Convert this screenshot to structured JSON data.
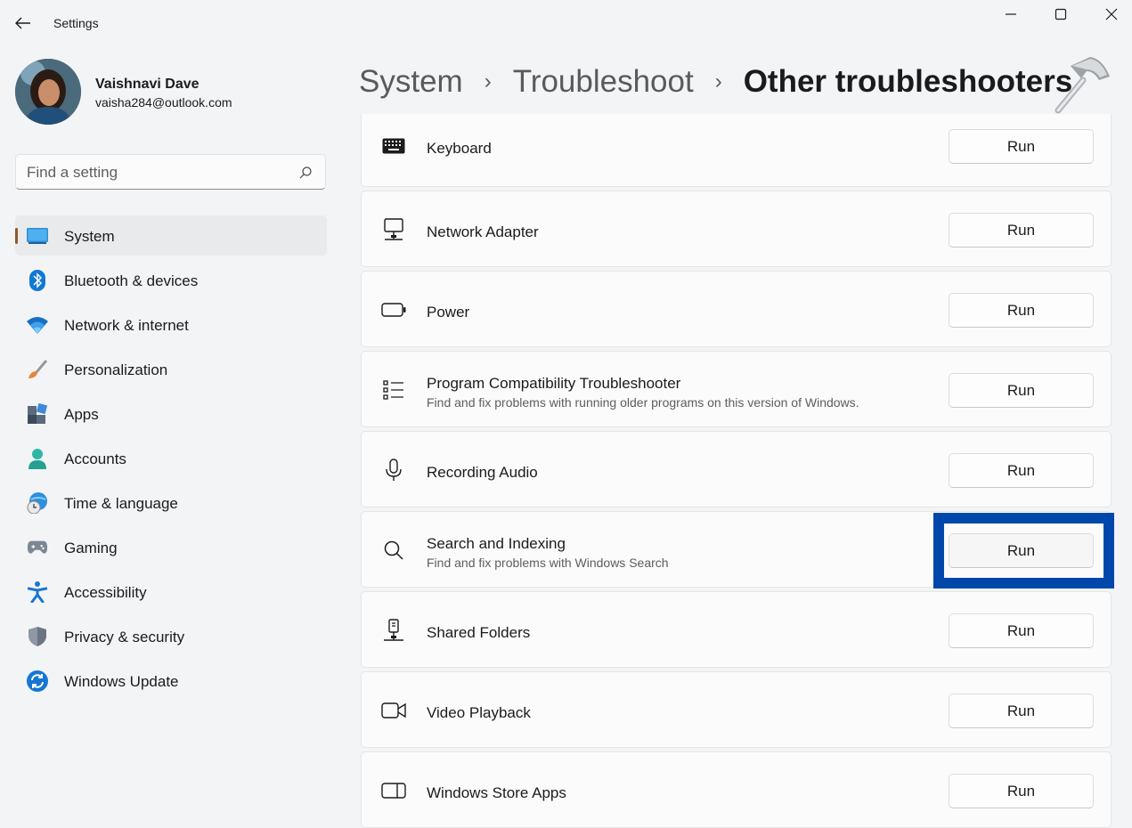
{
  "window": {
    "title": "Settings"
  },
  "user": {
    "name": "Vaishnavi Dave",
    "email": "vaisha284@outlook.com"
  },
  "search": {
    "placeholder": "Find a setting"
  },
  "sidebar": {
    "items": [
      {
        "label": "System",
        "icon": "system-icon",
        "active": true
      },
      {
        "label": "Bluetooth & devices",
        "icon": "bluetooth-icon"
      },
      {
        "label": "Network & internet",
        "icon": "wifi-icon"
      },
      {
        "label": "Personalization",
        "icon": "brush-icon"
      },
      {
        "label": "Apps",
        "icon": "apps-icon"
      },
      {
        "label": "Accounts",
        "icon": "person-icon"
      },
      {
        "label": "Time & language",
        "icon": "globe-clock-icon"
      },
      {
        "label": "Gaming",
        "icon": "gamepad-icon"
      },
      {
        "label": "Accessibility",
        "icon": "accessibility-icon"
      },
      {
        "label": "Privacy & security",
        "icon": "shield-icon"
      },
      {
        "label": "Windows Update",
        "icon": "update-icon"
      }
    ]
  },
  "breadcrumb": {
    "items": [
      "System",
      "Troubleshoot"
    ],
    "current": "Other troubleshooters",
    "separator": "›"
  },
  "troubleshooters": [
    {
      "title": "Keyboard",
      "description": "",
      "icon": "keyboard-icon",
      "button": "Run"
    },
    {
      "title": "Network Adapter",
      "description": "",
      "icon": "network-adapter-icon",
      "button": "Run"
    },
    {
      "title": "Power",
      "description": "",
      "icon": "battery-icon",
      "button": "Run"
    },
    {
      "title": "Program Compatibility Troubleshooter",
      "description": "Find and fix problems with running older programs on this version of Windows.",
      "icon": "list-icon",
      "button": "Run"
    },
    {
      "title": "Recording Audio",
      "description": "",
      "icon": "microphone-icon",
      "button": "Run"
    },
    {
      "title": "Search and Indexing",
      "description": "Find and fix problems with Windows Search",
      "icon": "search-icon",
      "button": "Run",
      "highlighted": true
    },
    {
      "title": "Shared Folders",
      "description": "",
      "icon": "shared-folder-icon",
      "button": "Run"
    },
    {
      "title": "Video Playback",
      "description": "",
      "icon": "video-camera-icon",
      "button": "Run"
    },
    {
      "title": "Windows Store Apps",
      "description": "",
      "icon": "store-app-icon",
      "button": "Run"
    }
  ],
  "colors": {
    "accent": "#0067c0",
    "highlight_frame": "#0047ab",
    "active_indicator": "#8b5a2b"
  }
}
